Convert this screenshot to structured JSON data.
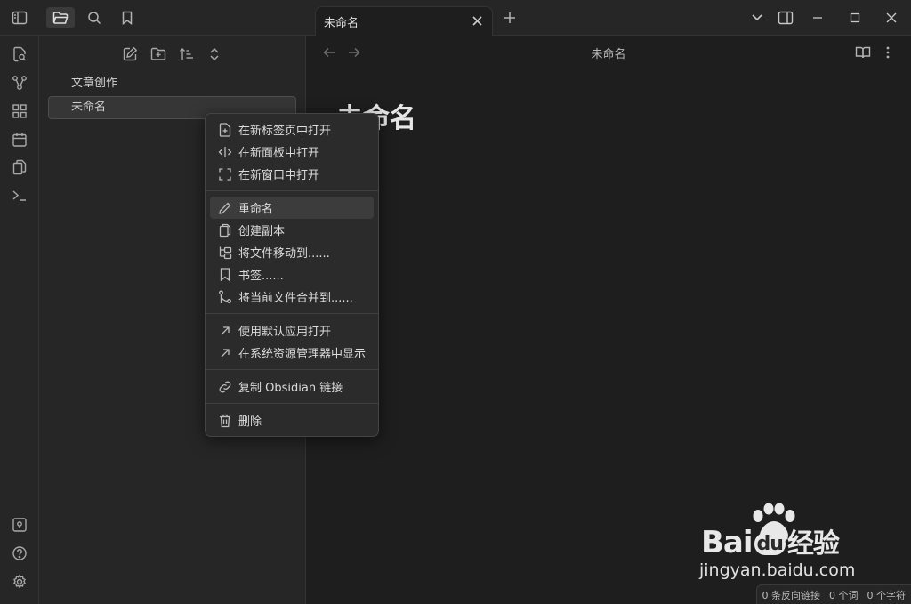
{
  "tab": {
    "title": "未命名"
  },
  "sidebar": {
    "tree": [
      {
        "label": "文章创作"
      },
      {
        "label": "未命名"
      }
    ]
  },
  "main": {
    "view_title": "未命名",
    "heading": "未命名"
  },
  "context_menu": {
    "group1": [
      "在新标签页中打开",
      "在新面板中打开",
      "在新窗口中打开"
    ],
    "group2": [
      "重命名",
      "创建副本",
      "将文件移动到......",
      "书签......",
      "将当前文件合并到......"
    ],
    "group3": [
      "使用默认应用打开",
      "在系统资源管理器中显示"
    ],
    "group4": [
      "复制 Obsidian 链接"
    ],
    "group5": [
      "删除"
    ]
  },
  "statusbar": {
    "backlinks": "0 条反向链接",
    "words": "0 个词",
    "chars": "0 个字符"
  },
  "watermark": {
    "brand_a": "Bai",
    "brand_b": "du",
    "brand_c": "经验",
    "url": "jingyan.baidu.com"
  },
  "colors": {
    "background": "#1e1e1e",
    "panel": "#262626",
    "menu": "#2b2b2b"
  }
}
